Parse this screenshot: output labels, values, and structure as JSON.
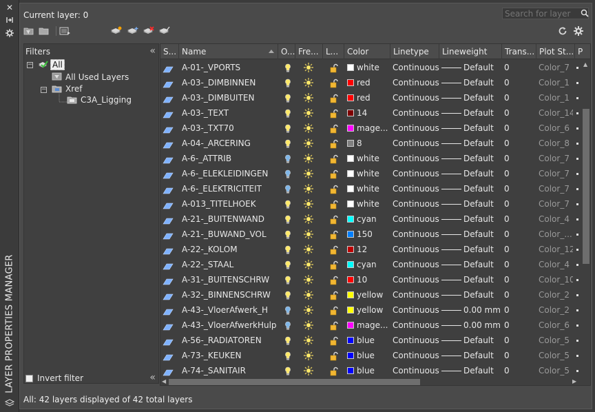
{
  "palette": {
    "title": "LAYER PROPERTIES MANAGER"
  },
  "header": {
    "current_layer": "Current layer: 0",
    "search_placeholder": "Search for layer"
  },
  "toolbar_icons": [
    "new-property-filter-icon",
    "new-group-filter-icon",
    "layer-states-manager-icon",
    "new-layer-icon",
    "new-layer-vp-frozen-icon",
    "delete-layer-icon",
    "set-current-icon",
    "refresh-icon",
    "settings-gear-icon"
  ],
  "filters": {
    "header": "Filters",
    "tree": [
      {
        "label": "All",
        "level": 0,
        "selected": true
      },
      {
        "label": "All Used Layers",
        "level": 1
      },
      {
        "label": "Xref",
        "level": 1
      },
      {
        "label": "C3A_Ligging",
        "level": 2
      }
    ],
    "invert_label": "Invert filter"
  },
  "columns": [
    "S...",
    "Name",
    "O...",
    "Fre...",
    "L...",
    "Color",
    "Linetype",
    "Lineweight",
    "Trans...",
    "Plot St...",
    "P"
  ],
  "layers": [
    {
      "name": "A-01-_VPORTS",
      "on": "on",
      "color_name": "white",
      "color_hex": "#ffffff",
      "linetype": "Continuous",
      "lineweight": "Default",
      "transparency": "0",
      "plot_style": "Color_7"
    },
    {
      "name": "A-03-_DIMBINNEN",
      "on": "on",
      "color_name": "red",
      "color_hex": "#ff0000",
      "linetype": "Continuous",
      "lineweight": "Default",
      "transparency": "0",
      "plot_style": "Color_1"
    },
    {
      "name": "A-03-_DIMBUITEN",
      "on": "on",
      "color_name": "red",
      "color_hex": "#ff0000",
      "linetype": "Continuous",
      "lineweight": "Default",
      "transparency": "0",
      "plot_style": "Color_1"
    },
    {
      "name": "A-03-_TEXT",
      "on": "on",
      "color_name": "14",
      "color_hex": "#7f0000",
      "linetype": "Continuous",
      "lineweight": "Default",
      "transparency": "0",
      "plot_style": "Color_14"
    },
    {
      "name": "A-03-_TXT70",
      "on": "on",
      "color_name": "mage...",
      "color_hex": "#ff00ff",
      "linetype": "Continuous",
      "lineweight": "Default",
      "transparency": "0",
      "plot_style": "Color_6"
    },
    {
      "name": "A-04-_ARCERING",
      "on": "on",
      "color_name": "8",
      "color_hex": "#808080",
      "linetype": "Continuous",
      "lineweight": "Default",
      "transparency": "0",
      "plot_style": "Color_8"
    },
    {
      "name": "A-6-_ATTRIB",
      "on": "off",
      "color_name": "white",
      "color_hex": "#ffffff",
      "linetype": "Continuous",
      "lineweight": "Default",
      "transparency": "0",
      "plot_style": "Color_7"
    },
    {
      "name": "A-6-_ELEKLEIDINGEN",
      "on": "off",
      "color_name": "white",
      "color_hex": "#ffffff",
      "linetype": "Continuous",
      "lineweight": "Default",
      "transparency": "0",
      "plot_style": "Color_7"
    },
    {
      "name": "A-6-_ELEKTRICITEIT",
      "on": "off",
      "color_name": "white",
      "color_hex": "#ffffff",
      "linetype": "Continuous",
      "lineweight": "Default",
      "transparency": "0",
      "plot_style": "Color_7"
    },
    {
      "name": "A-013_TITELHOEK",
      "on": "on",
      "color_name": "white",
      "color_hex": "#ffffff",
      "linetype": "Continuous",
      "lineweight": "Default",
      "transparency": "0",
      "plot_style": "Color_7"
    },
    {
      "name": "A-21-_BUITENWAND",
      "on": "on",
      "color_name": "cyan",
      "color_hex": "#00ffff",
      "linetype": "Continuous",
      "lineweight": "Default",
      "transparency": "0",
      "plot_style": "Color_4"
    },
    {
      "name": "A-21-_BUWAND_VOL",
      "on": "on",
      "color_name": "150",
      "color_hex": "#007fff",
      "linetype": "Continuous",
      "lineweight": "Default",
      "transparency": "0",
      "plot_style": "Color_..."
    },
    {
      "name": "A-22-_KOLOM",
      "on": "on",
      "color_name": "12",
      "color_hex": "#bd0000",
      "linetype": "Continuous",
      "lineweight": "Default",
      "transparency": "0",
      "plot_style": "Color_12"
    },
    {
      "name": "A-22-_STAAL",
      "on": "on",
      "color_name": "cyan",
      "color_hex": "#00ffff",
      "linetype": "Continuous",
      "lineweight": "Default",
      "transparency": "0",
      "plot_style": "Color_4"
    },
    {
      "name": "A-31-_BUITENSCHRW",
      "on": "on",
      "color_name": "10",
      "color_hex": "#ff0000",
      "linetype": "Continuous",
      "lineweight": "Default",
      "transparency": "0",
      "plot_style": "Color_10"
    },
    {
      "name": "A-32-_BINNENSCHRW",
      "on": "on",
      "color_name": "yellow",
      "color_hex": "#ffff00",
      "linetype": "Continuous",
      "lineweight": "Default",
      "transparency": "0",
      "plot_style": "Color_2"
    },
    {
      "name": "A-43-_VloerAfwerk_H",
      "on": "off",
      "color_name": "yellow",
      "color_hex": "#ffff00",
      "linetype": "Continuous",
      "lineweight": "0.00 mm",
      "transparency": "0",
      "plot_style": "Color_2"
    },
    {
      "name": "A-43-_VloerAfwerkHulp...",
      "on": "off",
      "color_name": "mage...",
      "color_hex": "#ff00ff",
      "linetype": "Continuous",
      "lineweight": "0.00 mm",
      "transparency": "0",
      "plot_style": "Color_6"
    },
    {
      "name": "A-56-_RADIATOREN",
      "on": "on",
      "color_name": "blue",
      "color_hex": "#0000ff",
      "linetype": "Continuous",
      "lineweight": "Default",
      "transparency": "0",
      "plot_style": "Color_5"
    },
    {
      "name": "A-73-_KEUKEN",
      "on": "on",
      "color_name": "blue",
      "color_hex": "#0000ff",
      "linetype": "Continuous",
      "lineweight": "Default",
      "transparency": "0",
      "plot_style": "Color_5"
    },
    {
      "name": "A-74-_SANITAIR",
      "on": "on",
      "color_name": "blue",
      "color_hex": "#0000ff",
      "linetype": "Continuous",
      "lineweight": "Default",
      "transparency": "0",
      "plot_style": "Color_5"
    }
  ],
  "status": "All: 42 layers displayed of 42 total layers"
}
